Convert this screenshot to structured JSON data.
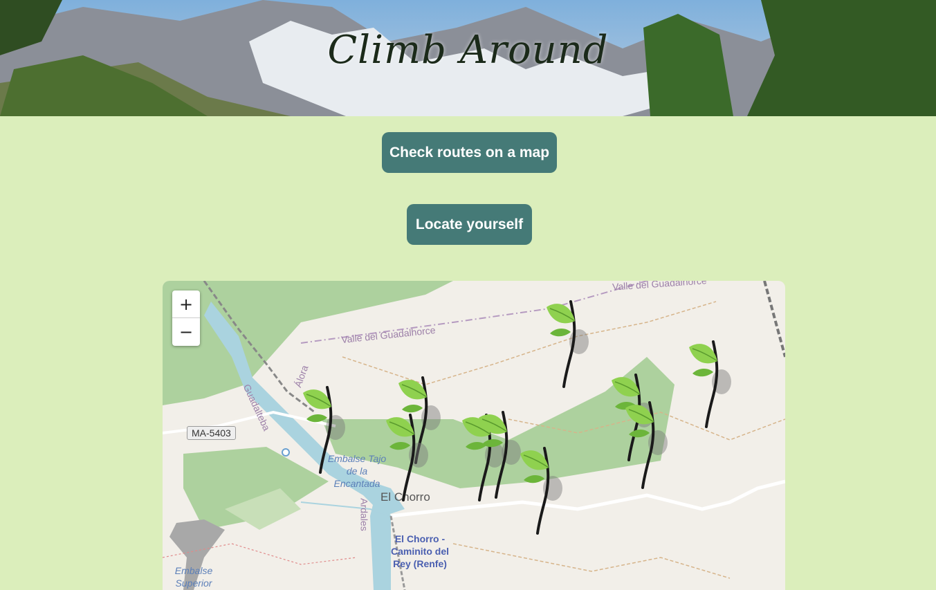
{
  "header": {
    "title": "Climb Around"
  },
  "buttons": {
    "map": "Check routes on a map",
    "locate": "Locate yourself"
  },
  "map": {
    "zoom_in": "+",
    "zoom_out": "−",
    "labels": {
      "valley_1": "Valle del Guadalhorce",
      "valley_2": "Valle del Guadalhorce",
      "aora": "Álora",
      "river": "Guadalteba",
      "road": "MA-5403",
      "reservoir": "Embalse Tajo de la Encantada",
      "ardales": "Ardales",
      "town": "El Chorro",
      "station": "El Chorro - Caminito del Rey (Renfe)",
      "reservoir_2": "Embalse Superior"
    },
    "marker_icon": "leaf-marker-icon",
    "marker_count": 10
  }
}
